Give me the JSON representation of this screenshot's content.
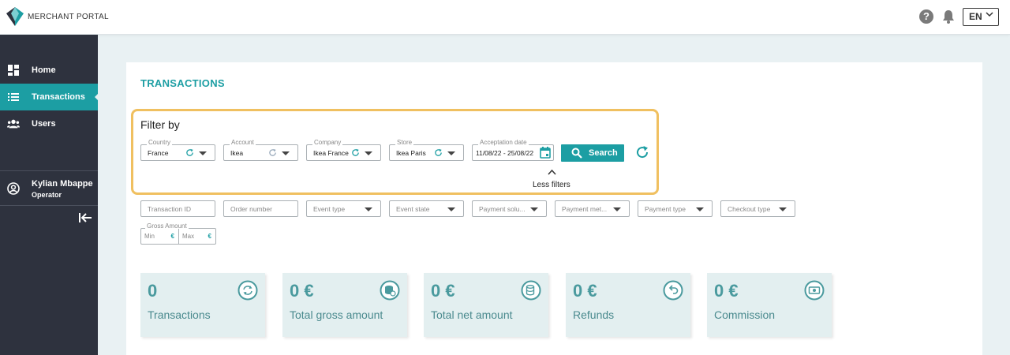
{
  "header": {
    "brand": "MERCHANT PORTAL",
    "language": "EN"
  },
  "sidebar": {
    "items": [
      {
        "label": "Home",
        "icon": "dashboard-icon"
      },
      {
        "label": "Transactions",
        "icon": "list-icon",
        "active": true
      },
      {
        "label": "Users",
        "icon": "users-icon"
      }
    ],
    "user": {
      "name": "Kylian Mbappe",
      "role": "Operator"
    }
  },
  "page": {
    "title": "TRANSACTIONS",
    "filter_title": "Filter by"
  },
  "filters": {
    "country": {
      "legend": "Country",
      "value": "France"
    },
    "account": {
      "legend": "Account",
      "value": "Ikea"
    },
    "company": {
      "legend": "Company",
      "value": "Ikea France"
    },
    "store": {
      "legend": "Store",
      "value": "Ikea Paris"
    },
    "date": {
      "legend": "Acceptation date",
      "value": "11/08/22 - 25/08/22"
    },
    "search_label": "Search",
    "less_filters": "Less filters"
  },
  "extra_filters": {
    "transaction_id": "Transaction ID",
    "order_number": "Order number",
    "event_type": "Event type",
    "event_state": "Event state",
    "payment_solution": "Payment solu...",
    "payment_method": "Payment met...",
    "payment_type": "Payment type",
    "checkout_type": "Checkout type",
    "gross_amount": {
      "legend": "Gross Amount",
      "min": "Min",
      "max": "Max",
      "currency": "€"
    }
  },
  "stats": [
    {
      "value": "0",
      "label": "Transactions",
      "icon": "sync-icon"
    },
    {
      "value": "0 €",
      "label": "Total gross amount",
      "icon": "coins-icon"
    },
    {
      "value": "0 €",
      "label": "Total net amount",
      "icon": "database-icon"
    },
    {
      "value": "0 €",
      "label": "Refunds",
      "icon": "undo-arrow-icon"
    },
    {
      "value": "0 €",
      "label": "Commission",
      "icon": "banknote-icon"
    }
  ],
  "colors": {
    "accent": "#1c9ea3",
    "sidebar": "#2e323e",
    "highlight": "#f0c060"
  }
}
